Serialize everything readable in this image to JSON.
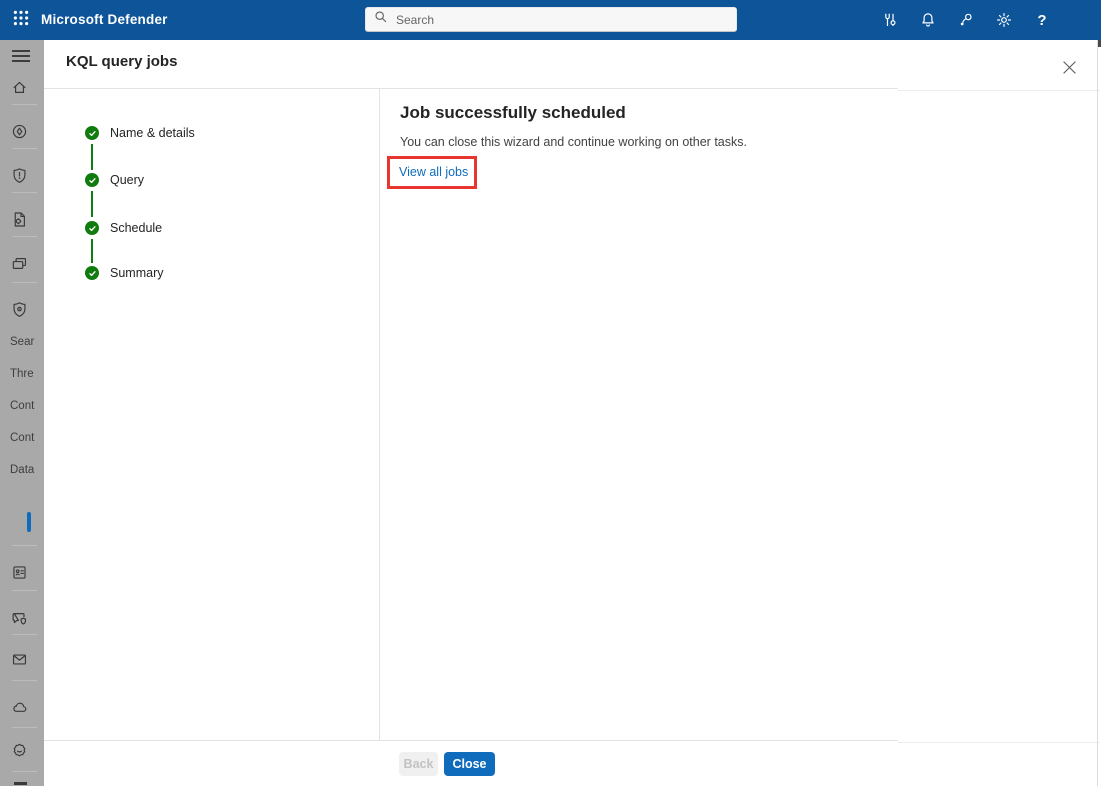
{
  "topbar": {
    "app_title": "Microsoft Defender",
    "search_placeholder": "Search",
    "icons": [
      "waffle-icon",
      "tools-icon",
      "notifications-icon",
      "feedback-icon",
      "settings-icon",
      "help-icon"
    ],
    "help_glyph": "?"
  },
  "sidebar": {
    "labels": [
      "Sear",
      "Thre",
      "Cont",
      "Cont",
      "Data"
    ],
    "icons": [
      "menu-icon",
      "home-icon",
      "incidents-icon",
      "actions-shield-icon",
      "report-icon",
      "devices-icon",
      "policy-shield-icon",
      "identity-card-icon",
      "chat-shield-icon",
      "email-icon",
      "cloud-icon",
      "defender-badge-icon"
    ]
  },
  "dialog": {
    "title": "KQL query jobs",
    "steps": [
      {
        "label": "Name & details",
        "state": "completed"
      },
      {
        "label": "Query",
        "state": "completed"
      },
      {
        "label": "Schedule",
        "state": "completed"
      },
      {
        "label": "Summary",
        "state": "completed"
      }
    ],
    "content": {
      "heading": "Job successfully scheduled",
      "message": "You can close this wizard and continue working on other tasks.",
      "link_label": "View all jobs"
    },
    "footer": {
      "back_label": "Back",
      "close_label": "Close"
    }
  },
  "colors": {
    "topbar_bg": "#0d5498",
    "accent_blue": "#0f6cbd",
    "step_green": "#107c10",
    "annotation_red": "#e9352f",
    "dimmed_sidebar_bg": "#a9a9a9"
  }
}
